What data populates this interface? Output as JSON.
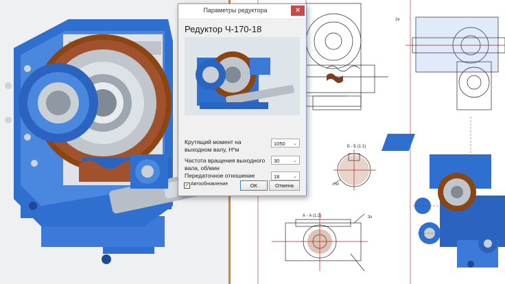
{
  "dialog": {
    "title": "Параметры редуктора",
    "heading": "Редуктор Ч-170-18",
    "close_glyph": "✕",
    "params": [
      {
        "label_lines": [
          "Крутящий момент на",
          "выходном валу, Н*м"
        ],
        "value": "1050"
      },
      {
        "label_lines": [
          "Частота вращения выходного",
          "вала, об/мин"
        ],
        "value": "30"
      },
      {
        "label_lines": [
          "Передаточное отношение"
        ],
        "value": "18"
      }
    ],
    "autoupdate_label": "Автообновление",
    "autoupdate_checked": true,
    "ok_label": "OK",
    "cancel_label": "Отмена"
  },
  "drawing": {
    "section_b": "Б - Б (1:1)",
    "section_a": "А - А (1:2)",
    "callout_1": "2x",
    "callout_2": "3x",
    "dimension": "∅50"
  },
  "colors": {
    "housing": "#2f6fd0",
    "gear": "#a0522d",
    "split": "#d9822b"
  },
  "icons": [
    "close-icon",
    "chevron-down-icon",
    "checkbox-icon"
  ]
}
